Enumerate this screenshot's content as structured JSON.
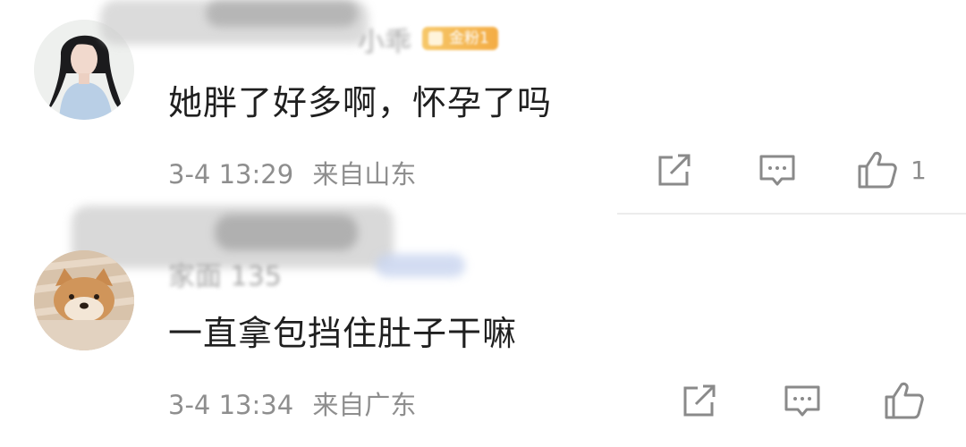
{
  "comments": [
    {
      "text": "她胖了好多啊，怀孕了吗",
      "time": "3-4 13:29",
      "location": "来自山东",
      "username": "小乖",
      "badge": "金粉1",
      "like_count": "1",
      "avatar": "avatar-girl"
    },
    {
      "text": "一直拿包挡住肚子干嘛",
      "time": "3-4 13:34",
      "location": "来自广东",
      "username": "家面 135",
      "badge": "",
      "like_count": "",
      "avatar": "avatar-shiba-dog"
    }
  ],
  "icons": {
    "share": "share-square-arrow-icon",
    "reply": "comment-bubble-icon",
    "like": "thumbs-up-icon"
  },
  "colors": {
    "text": "#1f1f1f",
    "meta": "#8e8e8e",
    "icon": "#8a8a8a",
    "badge": "#f3a431"
  }
}
